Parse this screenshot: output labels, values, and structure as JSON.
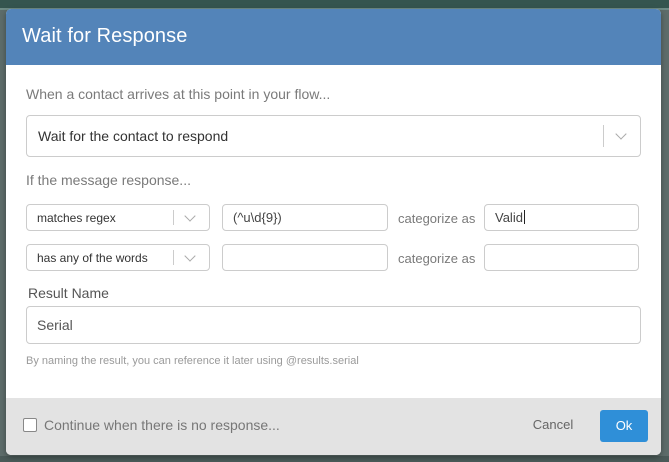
{
  "modal": {
    "title": "Wait for Response"
  },
  "intro": {
    "text": "When a contact arrives at this point in your flow..."
  },
  "action_select": {
    "value": "Wait for the contact to respond"
  },
  "rules": {
    "label": "If the message response...",
    "items": [
      {
        "operator": "matches regex",
        "argument": "(^u\\d{9})",
        "categorize_label": "categorize as",
        "category": "Valid"
      },
      {
        "operator": "has any of the words",
        "argument": "",
        "categorize_label": "categorize as",
        "category": ""
      }
    ]
  },
  "result": {
    "label": "Result Name",
    "value": "Serial",
    "hint": "By naming the result, you can reference it later using @results.serial"
  },
  "footer": {
    "checkbox_label": "Continue when there is no response...",
    "checkbox_checked": false,
    "cancel_label": "Cancel",
    "ok_label": "Ok"
  },
  "colors": {
    "header": "#5384b9",
    "ok_button": "#2f8fd8",
    "footer": "#e3e3e3"
  }
}
